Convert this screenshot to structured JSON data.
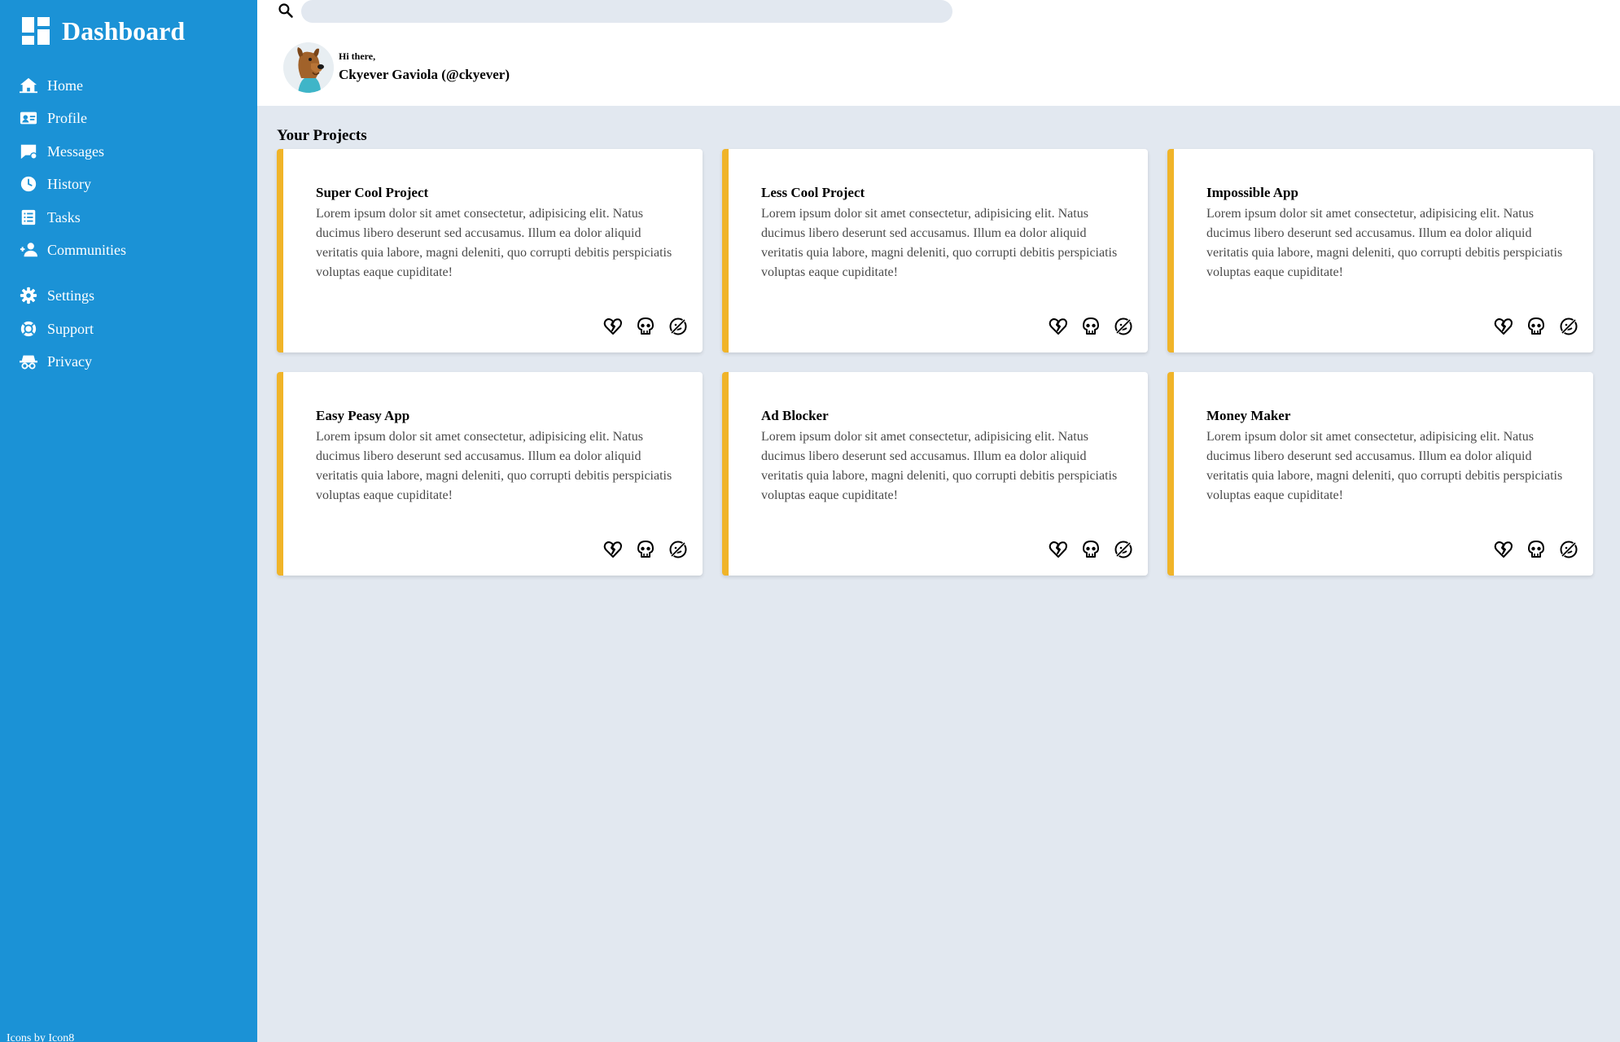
{
  "sidebar": {
    "title": "Dashboard",
    "items": [
      {
        "label": "Home",
        "icon": "home-icon"
      },
      {
        "label": "Profile",
        "icon": "id-card-icon"
      },
      {
        "label": "Messages",
        "icon": "message-icon"
      },
      {
        "label": "History",
        "icon": "clock-icon"
      },
      {
        "label": "Tasks",
        "icon": "list-icon"
      },
      {
        "label": "Communities",
        "icon": "people-icon"
      },
      {
        "label": "Settings",
        "icon": "gear-icon"
      },
      {
        "label": "Support",
        "icon": "support-icon"
      },
      {
        "label": "Privacy",
        "icon": "incognito-icon"
      }
    ],
    "credit": "Icons by Icon8"
  },
  "header": {
    "search": {
      "placeholder": "",
      "value": ""
    },
    "greeting": "Hi there,",
    "user": "Ckyever Gaviola (@ckyever)"
  },
  "main": {
    "section_title": "Your Projects",
    "projects": [
      {
        "title": "Super Cool Project",
        "description": "Lorem ipsum dolor sit amet consectetur, adipisicing elit. Natus ducimus libero deserunt sed accusamus. Illum ea dolor aliquid veritatis quia labore, magni deleniti, quo corrupti debitis perspiciatis voluptas eaque cupiditate!"
      },
      {
        "title": "Less Cool Project",
        "description": "Lorem ipsum dolor sit amet consectetur, adipisicing elit. Natus ducimus libero deserunt sed accusamus. Illum ea dolor aliquid veritatis quia labore, magni deleniti, quo corrupti debitis perspiciatis voluptas eaque cupiditate!"
      },
      {
        "title": "Impossible App",
        "description": "Lorem ipsum dolor sit amet consectetur, adipisicing elit. Natus ducimus libero deserunt sed accusamus. Illum ea dolor aliquid veritatis quia labore, magni deleniti, quo corrupti debitis perspiciatis voluptas eaque cupiditate!"
      },
      {
        "title": "Easy Peasy App",
        "description": "Lorem ipsum dolor sit amet consectetur, adipisicing elit. Natus ducimus libero deserunt sed accusamus. Illum ea dolor aliquid veritatis quia labore, magni deleniti, quo corrupti debitis perspiciatis voluptas eaque cupiditate!"
      },
      {
        "title": "Ad Blocker",
        "description": "Lorem ipsum dolor sit amet consectetur, adipisicing elit. Natus ducimus libero deserunt sed accusamus. Illum ea dolor aliquid veritatis quia labore, magni deleniti, quo corrupti debitis perspiciatis voluptas eaque cupiditate!"
      },
      {
        "title": "Money Maker",
        "description": "Lorem ipsum dolor sit amet consectetur, adipisicing elit. Natus ducimus libero deserunt sed accusamus. Illum ea dolor aliquid veritatis quia labore, magni deleniti, quo corrupti debitis perspiciatis voluptas eaque cupiditate!"
      }
    ],
    "card_actions": [
      "broken-heart-icon",
      "skull-icon",
      "crossed-smiley-icon"
    ]
  },
  "colors": {
    "sidebar_bg": "#1b92d6",
    "page_bg": "#e2e8f0",
    "card_accent": "#f0b429",
    "card_text": "#4a4a4a"
  }
}
